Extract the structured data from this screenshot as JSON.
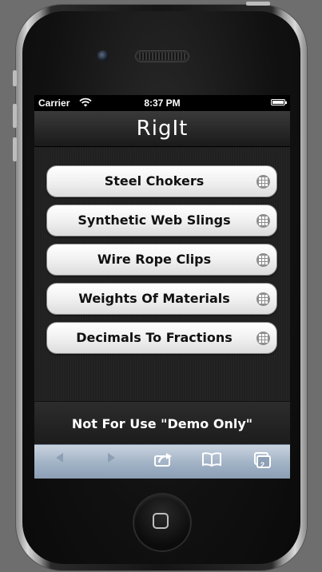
{
  "status_bar": {
    "carrier": "Carrier",
    "time": "8:37 PM"
  },
  "app": {
    "title": "RigIt"
  },
  "menu": {
    "items": [
      {
        "label": "Steel Chokers"
      },
      {
        "label": "Synthetic Web Slings"
      },
      {
        "label": "Wire Rope Clips"
      },
      {
        "label": "Weights Of Materials"
      },
      {
        "label": "Decimals To Fractions"
      }
    ]
  },
  "footer": {
    "notice": "Not For Use \"Demo Only\""
  },
  "safari_toolbar": {
    "tab_count": "2",
    "buttons": [
      "back-icon",
      "forward-icon",
      "share-icon",
      "bookmarks-icon",
      "tabs-icon"
    ]
  },
  "colors": {
    "menu_text": "#111111",
    "toolbar_blue": "#a3b4c7"
  }
}
